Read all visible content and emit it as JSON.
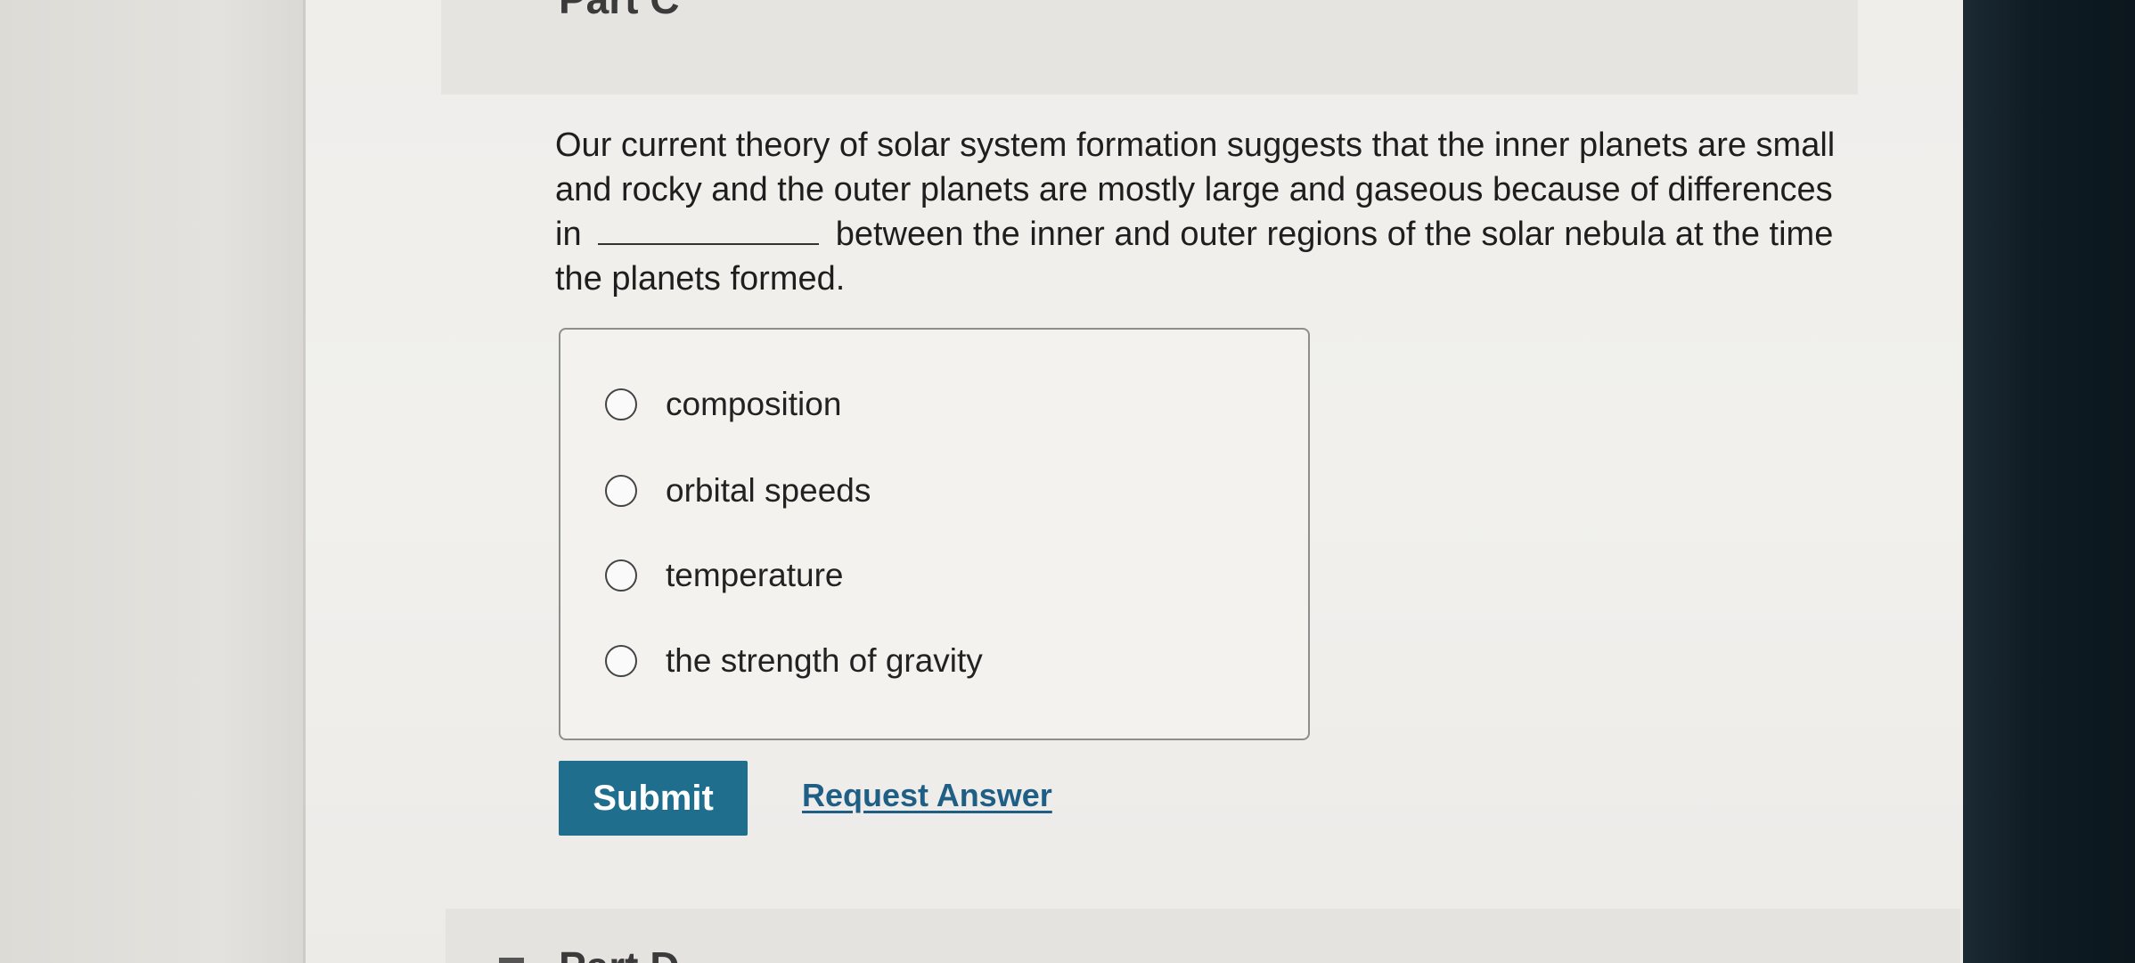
{
  "part_title": "Part C",
  "next_part_title": "Part D",
  "question": {
    "text_before_blank": "Our current theory of solar system formation suggests that the inner planets are small and rocky and the outer planets are mostly large and gaseous because of differences in",
    "text_after_blank": "between the inner and outer regions of the solar nebula at the time the planets formed."
  },
  "choices": [
    {
      "label": "composition",
      "selected": false
    },
    {
      "label": "orbital speeds",
      "selected": false
    },
    {
      "label": "temperature",
      "selected": false
    },
    {
      "label": "the strength of gravity",
      "selected": false
    }
  ],
  "actions": {
    "submit_label": "Submit",
    "request_answer_label": "Request Answer"
  },
  "colors": {
    "submit_button": "#1f6e8e",
    "link": "#1f5f86"
  },
  "icons": {
    "radio": "radio-unchecked-icon"
  }
}
